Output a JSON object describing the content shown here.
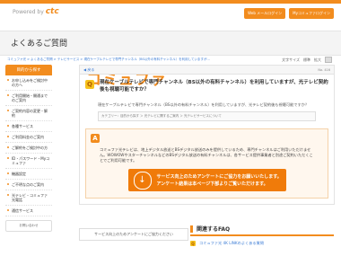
{
  "brand": {
    "name": "コミュファ",
    "sub_prefix": "Powered by",
    "sub_brand": "ctc"
  },
  "top_links": [
    "Web メールログイン",
    "Myコミュファログイン"
  ],
  "page_title": "よくあるご質問",
  "breadcrumb": "コミュファ光 > よくあるご質問 > テレビサービス > 現在ケーブルテレビで専門チャンネル（BS以外の有料チャンネル）を利用していますが…",
  "text_size_label": "文字サイズ",
  "text_size_options": [
    "標準",
    "拡大"
  ],
  "sidebar": {
    "header": "目的から探す",
    "items": [
      "お申し込みをご検討中の方へ",
      "ご利用開始・開通までのご案内",
      "ご契約内容の変更・解約",
      "各種サービス",
      "ご利用料金のご案内",
      "ご解約をご検討中の方",
      "ID・パスワード・Myコミュファ",
      "機器設定",
      "ご不明な点のご案内",
      "光テレビ・コミュファ光電話",
      "通信サービス"
    ],
    "box_label": "お問い合わせ"
  },
  "back_label": "◀ 戻る",
  "page_no": "No. 416",
  "question": {
    "title": "現在ケーブルテレビで専門チャンネル（BS以外の有料チャンネル）を利用していますが、光テレビ契約後も視聴可能ですか？",
    "body": "現在ケーブルテレビで専門チャンネル（BS以外の有料チャンネル）を利用していますが、光テレビ契約後も視聴可能ですか？",
    "category": "カテゴリー：目的から探す ＞ 光テレビに関するご案内 ＞ 光テレビサービスについて"
  },
  "answer": {
    "text": "コミュファ光テレビは、地上デジタル放送とBSデジタル放送のみを提供しているため、専門チャンネルはご利用いただけません。WOWOWやスターチャンネルなどのBSデジタル放送の有料チャンネルは、各サービス提供事業者と別途ご契約いただくことでご利用可能です。"
  },
  "cta": {
    "line1": "サービス向上のためアンケートにご協力をお願いいたします。",
    "line2": "アンケート結果は本ページ下部よりご覧いただけます。"
  },
  "survey_bar": "サービス向上のためアンケートにご協力ください",
  "faq": {
    "heading": "関連するFAQ",
    "items": [
      "コミュファ光 4K LINKのよくある質問"
    ]
  }
}
